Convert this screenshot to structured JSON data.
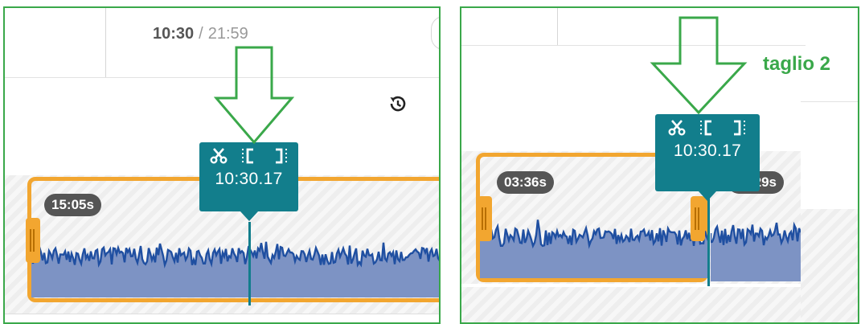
{
  "left_panel": {
    "current_time": "10:30",
    "separator": "/",
    "total_time": "21:59",
    "undo_icon": "history-undo-icon",
    "clip_duration": "15:05s",
    "tooltip": {
      "time": "10:30.17",
      "icons": [
        "scissors-icon",
        "mark-in-icon",
        "mark-out-icon"
      ]
    }
  },
  "right_panel": {
    "annotation": "taglio 2",
    "tooltip": {
      "time": "10:30.17",
      "icons": [
        "scissors-icon",
        "mark-in-icon",
        "mark-out-icon"
      ]
    },
    "clip_duration": "03:36s",
    "next_clip_duration": "11:29s"
  },
  "colors": {
    "annotation_border": "#3aa84a",
    "clip_border": "#f2a630",
    "waveform": "#1f4fa1",
    "waveform_fill": "#7d93c4",
    "tooltip_bg": "#127e8c",
    "badge_bg": "#555555"
  }
}
